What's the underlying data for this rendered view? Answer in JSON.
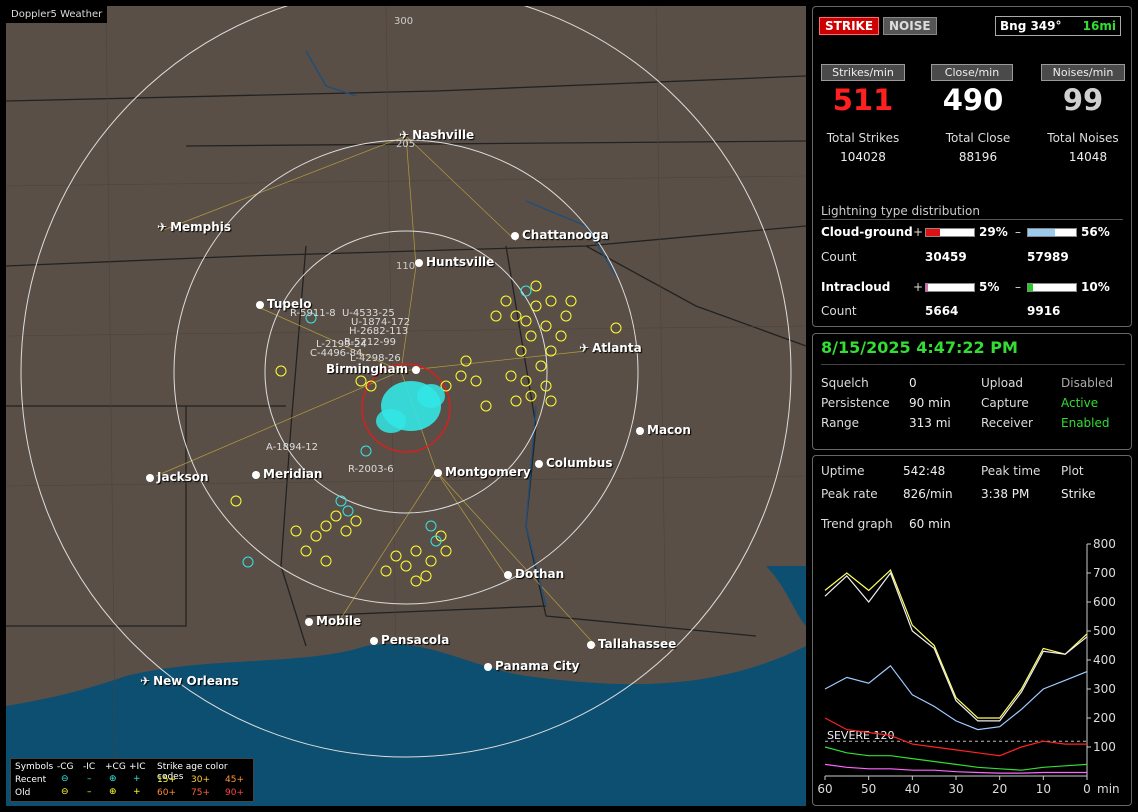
{
  "app": {
    "title": "Doppler5 Weather"
  },
  "map": {
    "range_labels": [
      "300",
      "205",
      "110"
    ],
    "cities": [
      {
        "name": "Nashville",
        "kind": "airport"
      },
      {
        "name": "Memphis",
        "kind": "airport"
      },
      {
        "name": "Chattanooga",
        "kind": "city"
      },
      {
        "name": "Huntsville",
        "kind": "city"
      },
      {
        "name": "Tupelo",
        "kind": "city"
      },
      {
        "name": "Atlanta",
        "kind": "airport"
      },
      {
        "name": "Birmingham",
        "kind": "city"
      },
      {
        "name": "Macon",
        "kind": "city"
      },
      {
        "name": "Jackson",
        "kind": "city"
      },
      {
        "name": "Meridian",
        "kind": "city"
      },
      {
        "name": "Montgomery",
        "kind": "city"
      },
      {
        "name": "Columbus",
        "kind": "city"
      },
      {
        "name": "Dothan",
        "kind": "city"
      },
      {
        "name": "Mobile",
        "kind": "city"
      },
      {
        "name": "Pensacola",
        "kind": "city"
      },
      {
        "name": "Tallahassee",
        "kind": "city"
      },
      {
        "name": "Panama City",
        "kind": "city"
      },
      {
        "name": "New Orleans",
        "kind": "airport"
      }
    ],
    "strike_tags": [
      "R-5911-8",
      "U-4533-25",
      "U-1874-172",
      "H-2682-113",
      "R-5212-99",
      "L-2199-24",
      "C-4496-84",
      "L-4298-26",
      "A-1894-12",
      "R-2003-6"
    ],
    "legend": {
      "header_symbols": "Symbols",
      "header_cols": [
        "-CG",
        "-IC",
        "+CG",
        "+IC"
      ],
      "header_age": "Strike age color codes",
      "row_recent": "Recent",
      "row_old": "Old",
      "recent_ages": [
        "15+",
        "30+",
        "45+"
      ],
      "old_ages": [
        "60+",
        "75+",
        "90+"
      ]
    },
    "colors": {
      "land": "#5a4f47",
      "water": "#0d4f70",
      "recent": "#33e6e6",
      "old": "#ffff33"
    }
  },
  "status": {
    "strike_btn": "STRIKE",
    "noise_btn": "NOISE",
    "bearing": "Bng 349°",
    "distance": "16mi",
    "strikes_min_label": "Strikes/min",
    "close_min_label": "Close/min",
    "noises_min_label": "Noises/min",
    "strikes_min": "511",
    "close_min": "490",
    "noises_min": "99",
    "total_strikes_label": "Total Strikes",
    "total_close_label": "Total Close",
    "total_noises_label": "Total Noises",
    "total_strikes": "104028",
    "total_close": "88196",
    "total_noises": "14048"
  },
  "distribution": {
    "title": "Lightning type distribution",
    "cg_label": "Cloud-ground",
    "ic_label": "Intracloud",
    "count_label": "Count",
    "plus": "+",
    "minus": "–",
    "cg_pos_pct": "29%",
    "cg_neg_pct": "56%",
    "cg_pos_count": "30459",
    "cg_neg_count": "57989",
    "ic_pos_pct": "5%",
    "ic_neg_pct": "10%",
    "ic_pos_count": "5664",
    "ic_neg_count": "9916",
    "cg_pos_frac": 0.29,
    "cg_neg_frac": 0.56,
    "ic_pos_frac": 0.05,
    "ic_neg_frac": 0.1
  },
  "settings": {
    "datetime": "8/15/2025 4:47:22 PM",
    "squelch_label": "Squelch",
    "squelch": "0",
    "persistence_label": "Persistence",
    "persistence": "90 min",
    "range_label": "Range",
    "range": "313 mi",
    "upload_label": "Upload",
    "upload": "Disabled",
    "capture_label": "Capture",
    "capture": "Active",
    "receiver_label": "Receiver",
    "receiver": "Enabled"
  },
  "stats": {
    "uptime_label": "Uptime",
    "uptime": "542:48",
    "peak_time_label": "Peak time",
    "peak_time": "3:38 PM",
    "plot_label": "Plot",
    "plot": "Strike",
    "peak_rate_label": "Peak rate",
    "peak_rate": "826/min",
    "trend_label": "Trend graph",
    "trend": "60 min"
  },
  "chart_data": {
    "type": "line",
    "x": [
      60,
      55,
      50,
      45,
      40,
      35,
      30,
      25,
      20,
      15,
      10,
      5,
      0
    ],
    "xlabel": "min",
    "x_ticks": [
      "60",
      "50",
      "40",
      "30",
      "20",
      "10",
      "0"
    ],
    "y_ticks": [
      "800",
      "700",
      "600",
      "500",
      "400",
      "300",
      "200",
      "100"
    ],
    "ylim": [
      0,
      800
    ],
    "severe_label": "SEVERE 120",
    "severe_value": 120,
    "series": [
      {
        "color": "#ffff66",
        "values": [
          640,
          700,
          640,
          710,
          520,
          450,
          270,
          200,
          200,
          300,
          440,
          420,
          490
        ]
      },
      {
        "color": "#eeeeee",
        "values": [
          620,
          690,
          600,
          700,
          500,
          440,
          260,
          190,
          190,
          290,
          430,
          420,
          480
        ]
      },
      {
        "color": "#9ecbff",
        "values": [
          300,
          340,
          320,
          380,
          280,
          240,
          190,
          160,
          170,
          230,
          300,
          330,
          360
        ]
      },
      {
        "color": "#ff2222",
        "values": [
          200,
          160,
          150,
          140,
          110,
          100,
          90,
          80,
          70,
          100,
          120,
          110,
          110
        ]
      },
      {
        "color": "#33dd33",
        "values": [
          100,
          80,
          70,
          70,
          60,
          50,
          40,
          30,
          25,
          20,
          30,
          35,
          40
        ]
      },
      {
        "color": "#ff66ff",
        "values": [
          40,
          30,
          25,
          25,
          20,
          20,
          15,
          12,
          10,
          10,
          12,
          12,
          12
        ]
      }
    ]
  }
}
